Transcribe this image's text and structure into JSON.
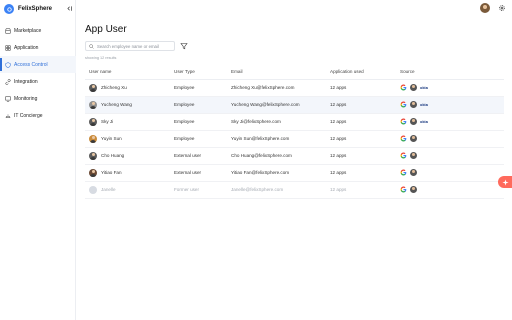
{
  "app": {
    "brand": "FelixSphere"
  },
  "sidebar": {
    "items": [
      {
        "label": "Marketplace",
        "icon": "store-icon",
        "active": false
      },
      {
        "label": "Application",
        "icon": "grid-icon",
        "active": false
      },
      {
        "label": "Access Control",
        "icon": "shield-icon",
        "active": true
      },
      {
        "label": "Integration",
        "icon": "link-icon",
        "active": false
      },
      {
        "label": "Monitoring",
        "icon": "monitor-icon",
        "active": false
      },
      {
        "label": "IT Concierge",
        "icon": "concierge-icon",
        "active": false
      }
    ]
  },
  "page": {
    "title": "App User",
    "search_placeholder": "Search employee name or email",
    "results_text": "showing 12 results"
  },
  "table": {
    "headers": [
      "User name",
      "User Type",
      "Email",
      "Application used",
      "Source"
    ],
    "rows": [
      {
        "name": "Zhicheng Xu",
        "type": "Employee",
        "email": "Zhicheng Xu@felixSphere.com",
        "apps": "12 apps",
        "okta": "okta",
        "avatar": "dark"
      },
      {
        "name": "Yucheng Wang",
        "type": "Employee",
        "email": "Yucheng Wang@felixSphere.com",
        "apps": "12 apps",
        "okta": "okta",
        "avatar": "mid"
      },
      {
        "name": "Sky Ji",
        "type": "Employee",
        "email": "Sky Ji@felixSphere.com",
        "apps": "12 apps",
        "okta": "okta",
        "avatar": "dark"
      },
      {
        "name": "Yuyin Sun",
        "type": "Employee",
        "email": "Yuyin Sun@felixSphere.com",
        "apps": "12 apps",
        "okta": "",
        "avatar": "warm"
      },
      {
        "name": "Cho Huang",
        "type": "External user",
        "email": "Cho Huang@felixSphere.com",
        "apps": "12 apps",
        "okta": "",
        "avatar": "dark"
      },
      {
        "name": "Yitiao Fan",
        "type": "External user",
        "email": "Yitiao Fan@felixSphere.com",
        "apps": "12 apps",
        "okta": "",
        "avatar": "brown"
      },
      {
        "name": "Janelle",
        "type": "Former user",
        "email": "Janelle@felixSphere.com",
        "apps": "12 apps",
        "okta": "",
        "avatar": "ghost"
      }
    ]
  },
  "colors": {
    "accent": "#2f6fd8",
    "fab": "#ff6a5c"
  }
}
